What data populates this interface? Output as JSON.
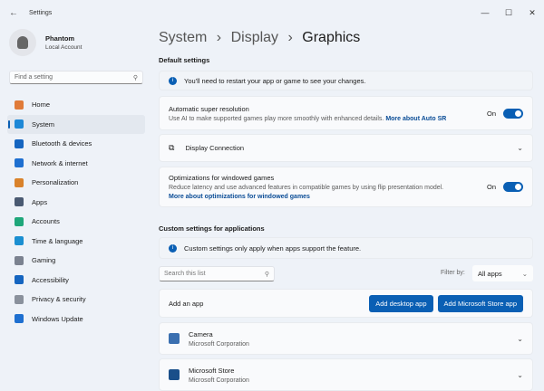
{
  "window": {
    "title": "Settings",
    "back": "←",
    "minimize": "—",
    "maximize": "☐",
    "close": "✕"
  },
  "profile": {
    "name": "Phantom",
    "account": "Local Account"
  },
  "search": {
    "placeholder": "Find a setting",
    "icon": "search-icon"
  },
  "nav": [
    {
      "label": "Home",
      "color": "#e07b39"
    },
    {
      "label": "System",
      "color": "#1e88d6",
      "selected": true
    },
    {
      "label": "Bluetooth & devices",
      "color": "#1565c0"
    },
    {
      "label": "Network & internet",
      "color": "#1e6fd0"
    },
    {
      "label": "Personalization",
      "color": "#d9822b"
    },
    {
      "label": "Apps",
      "color": "#4a5a72"
    },
    {
      "label": "Accounts",
      "color": "#1fa77a"
    },
    {
      "label": "Time & language",
      "color": "#1b8fd1"
    },
    {
      "label": "Gaming",
      "color": "#7b8290"
    },
    {
      "label": "Accessibility",
      "color": "#1565c0"
    },
    {
      "label": "Privacy & security",
      "color": "#8a919c"
    },
    {
      "label": "Windows Update",
      "color": "#1e6fd0"
    }
  ],
  "breadcrumb": {
    "part1": "System",
    "part2": "Display",
    "current": "Graphics",
    "sep": "›"
  },
  "default_settings": {
    "heading": "Default settings",
    "info": "You'll need to restart your app or game to see your changes.",
    "auto_sr": {
      "title": "Automatic super resolution",
      "desc": "Use AI to make supported games play more smoothly with enhanced details.",
      "link": "More about Auto SR",
      "state": "On"
    },
    "display_connection": {
      "title": "Display Connection"
    },
    "windowed": {
      "title": "Optimizations for windowed games",
      "desc": "Reduce latency and use advanced features in compatible games by using flip presentation model.",
      "link": "More about optimizations for windowed games",
      "state": "On"
    }
  },
  "custom": {
    "heading": "Custom settings for applications",
    "info": "Custom settings only apply when apps support the feature.",
    "search_placeholder": "Search this list",
    "filter_label": "Filter by:",
    "filter_value": "All apps",
    "add_label": "Add an app",
    "add_desktop": "Add desktop app",
    "add_store": "Add Microsoft Store app",
    "apps": [
      {
        "name": "Camera",
        "publisher": "Microsoft Corporation"
      },
      {
        "name": "Microsoft Store",
        "publisher": "Microsoft Corporation"
      }
    ]
  },
  "accent": "#0a5fb4"
}
